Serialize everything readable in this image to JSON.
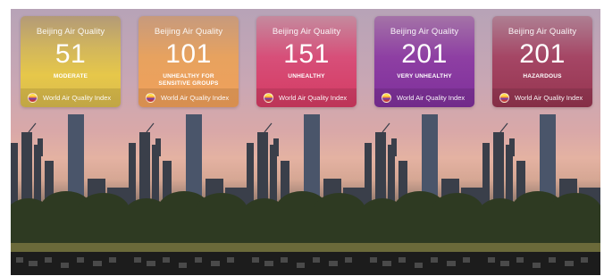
{
  "panels": [
    {
      "title": "Beijing Air Quality",
      "aqi": "51",
      "status_line1": "MODERATE",
      "status_line2": "",
      "footer": "World Air Quality Index",
      "footer_icon": "flag-icon"
    },
    {
      "title": "Beijing Air Quality",
      "aqi": "101",
      "status_line1": "UNHEALTHY FOR",
      "status_line2": "SENSITIVE GROUPS",
      "footer": "World Air Quality Index",
      "footer_icon": "flag-icon"
    },
    {
      "title": "Beijing Air Quality",
      "aqi": "151",
      "status_line1": "UNHEALTHY",
      "status_line2": "",
      "footer": "World Air Quality Index",
      "footer_icon": "flag-icon"
    },
    {
      "title": "Beijing Air Quality",
      "aqi": "201",
      "status_line1": "VERY UNHEALTHY",
      "status_line2": "",
      "footer": "World Air Quality Index",
      "footer_icon": "flag-icon"
    },
    {
      "title": "Beijing Air Quality",
      "aqi": "201",
      "status_line1": "HAZARDOUS",
      "status_line2": "",
      "footer": "World Air Quality Index",
      "footer_icon": "flag-icon"
    }
  ],
  "colors": {
    "moderate": "#e6c74a",
    "unhealthy_sensitive": "#f1a05a",
    "unhealthy": "#d43a62",
    "very_unhealthy": "#7e2f9a",
    "hazardous": "#95344f"
  }
}
